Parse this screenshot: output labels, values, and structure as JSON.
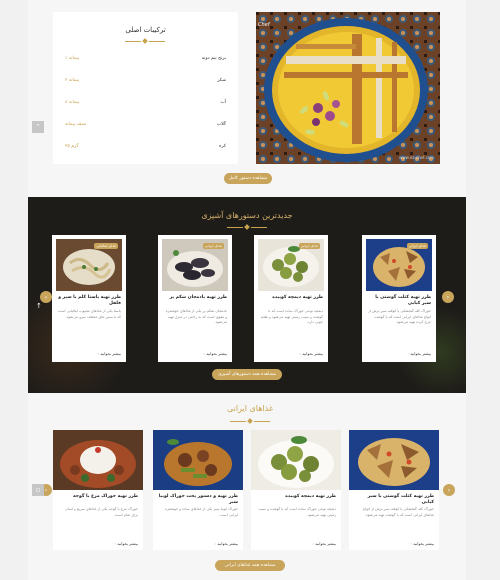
{
  "ingredients": {
    "title": "ترکیبات اصلی",
    "items": [
      {
        "name": "برنج نیم دونه",
        "qty": "۱ پیمانه"
      },
      {
        "name": "شکر",
        "qty": "۲ پیمانه"
      },
      {
        "name": "آب",
        "qty": "۸ پیمانه"
      },
      {
        "name": "گلاب",
        "qty": "نصف پیمانه"
      },
      {
        "name": "کره",
        "qty": "۲۵ گرم"
      }
    ]
  },
  "photo": {
    "logo": "Chef",
    "watermark": "www.ez-chef.com"
  },
  "top_button": "مشاهده دستور کامل",
  "latest": {
    "title": "جدیدترین دستورهای آشپزی",
    "more_label": "بیشتر بخوانید",
    "all_button": "مشاهده همه دستورهای آشپزی",
    "cards": [
      {
        "badge": "غذای ایرانی",
        "title": "طرز تهیه کتلت گوشتی با سیر کبابی",
        "desc": "خوراک کله گنجشکی یا کوفته سیر ترش از انواع غذاهای ایرانی است که با گوشت چرخ کرده تهیه می‌شود."
      },
      {
        "badge": "غذای ایرانی",
        "title": "طرز تهیه دیمچه کوبیده",
        "desc": "دیمچه نوعی خوراک ساده است که با گوشت و سیب زمینی تهیه می‌شود و طعم خوبی دارد."
      },
      {
        "badge": "غذای ایرانی",
        "title": "طرز تهیه بادمجان شکم پر",
        "desc": "بادمجان شکم پر یکی از غذاهای خوشمزه و مقوی است که به راحتی در منزل تهیه می‌شود."
      },
      {
        "badge": "غذای ایتالیایی",
        "title": "طرز تهیه پاستا کلم با سیر و فلفل",
        "desc": "پاستا یکی از غذاهای محبوب ایتالیایی است که با سس های مختلف سرو می‌شود."
      }
    ]
  },
  "iranian": {
    "title": "غذاهای ایرانی",
    "more_label": "بیشتر بخوانید",
    "all_button": "مشاهده همه غذاهای ایرانی",
    "cards": [
      {
        "title": "طرز تهیه کتلت گوشتی با سیر کبابی",
        "desc": "خوراک کله گنجشکی یا کوفته سیر ترش از انواع غذاهای ایرانی است که با گوشت تهیه می‌شود."
      },
      {
        "title": "طرز تهیه دیمچه کوبیده",
        "desc": "دیمچه نوعی خوراک ساده است که با گوشت و سیب زمینی تهیه می‌شود."
      },
      {
        "title": "طرز تهیه و دستور پخت خوراک لوبیا سبز",
        "desc": "خوراک لوبیا سبز یکی از غذاهای ساده و خوشمزه ایرانی است."
      },
      {
        "title": "طرز تهیه خوراک مرغ با گوجه",
        "desc": "خوراک مرغ با گوجه یکی از غذاهای سریع و آسان برای شام است."
      }
    ]
  }
}
